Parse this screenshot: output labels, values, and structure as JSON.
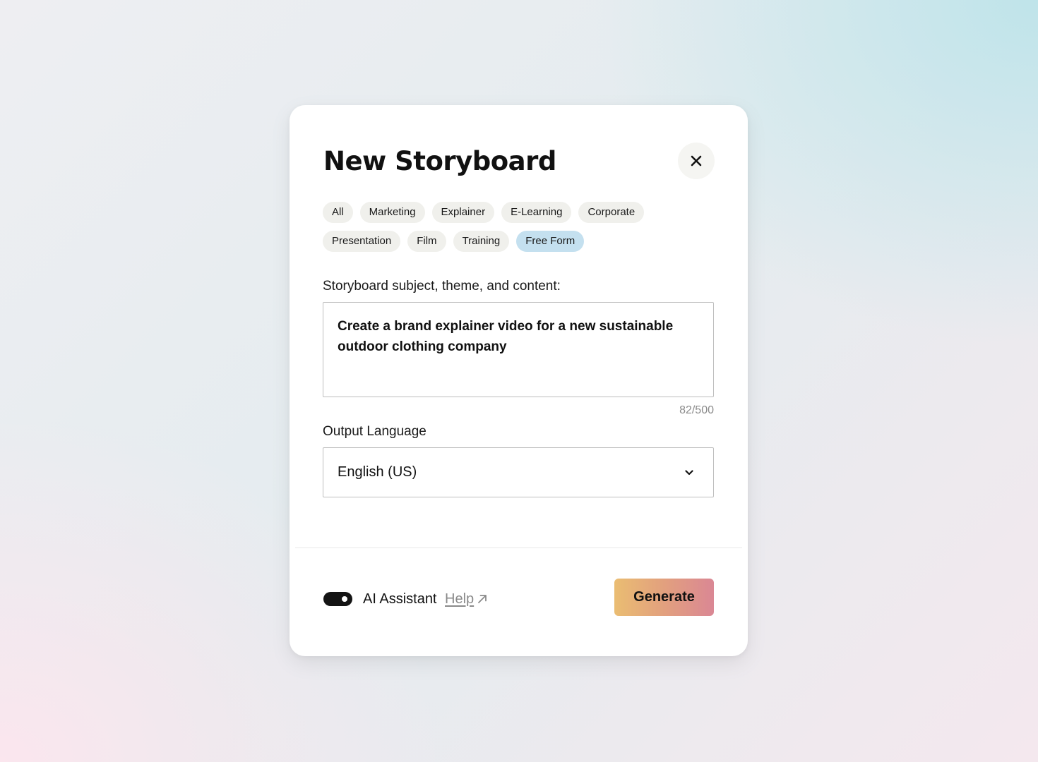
{
  "dialog": {
    "title": "New Storyboard",
    "close_icon": "close-icon"
  },
  "categories": [
    {
      "label": "All",
      "selected": false
    },
    {
      "label": "Marketing",
      "selected": false
    },
    {
      "label": "Explainer",
      "selected": false
    },
    {
      "label": "E-Learning",
      "selected": false
    },
    {
      "label": "Corporate",
      "selected": false
    },
    {
      "label": "Presentation",
      "selected": false
    },
    {
      "label": "Film",
      "selected": false
    },
    {
      "label": "Training",
      "selected": false
    },
    {
      "label": "Free Form",
      "selected": true
    }
  ],
  "subject": {
    "label": "Storyboard subject, theme, and content:",
    "value": "Create a brand explainer video for a new sustainable outdoor clothing company",
    "counter": "82/500"
  },
  "language": {
    "label": "Output Language",
    "selected": "English (US)",
    "chevron_icon": "chevron-down-icon"
  },
  "footer": {
    "toggle_on": true,
    "ai_assistant_label": "AI Assistant",
    "help_label": "Help",
    "help_icon": "arrow-up-right-icon",
    "generate_label": "Generate"
  },
  "colors": {
    "chip_bg": "#f0f0ec",
    "chip_selected_bg": "#c4e0ef",
    "toggle_bg": "#141414",
    "generate_gradient_start": "#eabd72",
    "generate_gradient_end": "#da8794"
  }
}
